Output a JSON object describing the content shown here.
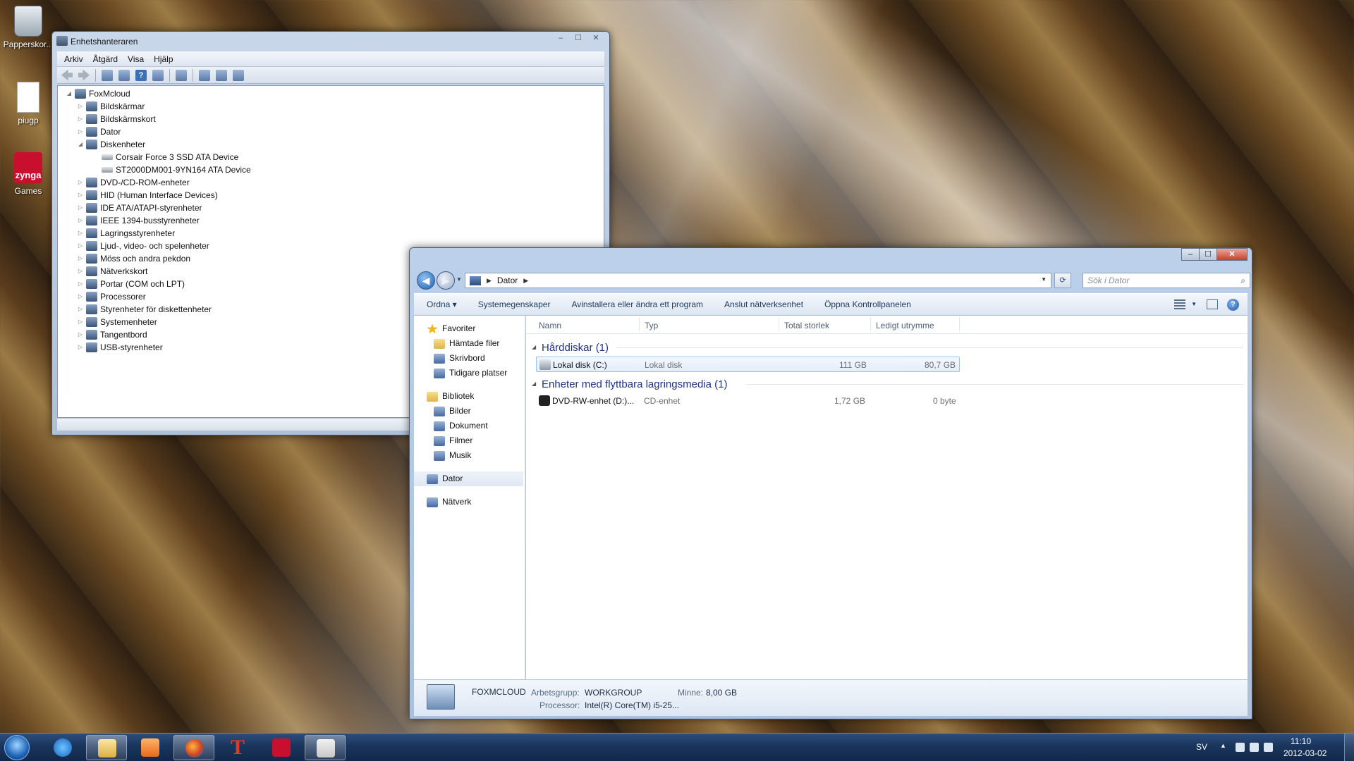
{
  "desktop": {
    "icons": [
      {
        "label": "Papperskor..."
      },
      {
        "label": "piugp"
      },
      {
        "label": "Games",
        "logo_text": "zynga"
      }
    ]
  },
  "devmgr": {
    "title": "Enhetshanteraren",
    "window_buttons": {
      "minimize": "‒",
      "maximize": "☐",
      "close": "✕"
    },
    "menu": [
      "Arkiv",
      "Åtgärd",
      "Visa",
      "Hjälp"
    ],
    "tree": {
      "root": "FoxMcloud",
      "items": [
        {
          "label": "Bildskärmar",
          "expanded": false
        },
        {
          "label": "Bildskärmskort",
          "expanded": false
        },
        {
          "label": "Dator",
          "expanded": false
        },
        {
          "label": "Diskenheter",
          "expanded": true,
          "children": [
            "Corsair Force 3 SSD ATA Device",
            "ST2000DM001-9YN164 ATA Device"
          ]
        },
        {
          "label": "DVD-/CD-ROM-enheter",
          "expanded": false
        },
        {
          "label": "HID (Human Interface Devices)",
          "expanded": false
        },
        {
          "label": "IDE ATA/ATAPI-styrenheter",
          "expanded": false
        },
        {
          "label": "IEEE 1394-busstyrenheter",
          "expanded": false
        },
        {
          "label": "Lagringsstyrenheter",
          "expanded": false
        },
        {
          "label": "Ljud-, video- och spelenheter",
          "expanded": false
        },
        {
          "label": "Möss och andra pekdon",
          "expanded": false
        },
        {
          "label": "Nätverkskort",
          "expanded": false
        },
        {
          "label": "Portar (COM och LPT)",
          "expanded": false
        },
        {
          "label": "Processorer",
          "expanded": false
        },
        {
          "label": "Styrenheter för diskettenheter",
          "expanded": false
        },
        {
          "label": "Systemenheter",
          "expanded": false
        },
        {
          "label": "Tangentbord",
          "expanded": false
        },
        {
          "label": "USB-styrenheter",
          "expanded": false
        }
      ]
    }
  },
  "explorer": {
    "window_buttons": {
      "minimize": "‒",
      "maximize": "☐",
      "close": "✕"
    },
    "address": {
      "location": "Dator"
    },
    "search_placeholder": "Sök i Dator",
    "commands": [
      "Ordna ▾",
      "Systemegenskaper",
      "Avinstallera eller ändra ett program",
      "Anslut nätverksenhet",
      "Öppna Kontrollpanelen"
    ],
    "nav": {
      "favorites": {
        "label": "Favoriter",
        "items": [
          "Hämtade filer",
          "Skrivbord",
          "Tidigare platser"
        ]
      },
      "libraries": {
        "label": "Bibliotek",
        "items": [
          "Bilder",
          "Dokument",
          "Filmer",
          "Musik"
        ]
      },
      "computer": "Dator",
      "network": "Nätverk"
    },
    "columns": [
      "Namn",
      "Typ",
      "Total storlek",
      "Ledigt utrymme"
    ],
    "groups": [
      {
        "label": "Hårddiskar (1)",
        "rows": [
          {
            "name": "Lokal disk (C:)",
            "type": "Lokal disk",
            "total": "111 GB",
            "free": "80,7 GB"
          }
        ]
      },
      {
        "label": "Enheter med flyttbara lagringsmedia (1)",
        "rows": [
          {
            "name": "DVD-RW-enhet (D:)...",
            "type": "CD-enhet",
            "total": "1,72 GB",
            "free": "0 byte"
          }
        ]
      }
    ],
    "details": {
      "name": "FOXMCLOUD",
      "workgroup_label": "Arbetsgrupp:",
      "workgroup": "WORKGROUP",
      "memory_label": "Minne:",
      "memory": "8,00 GB",
      "processor_label": "Processor:",
      "processor": "Intel(R) Core(TM) i5-25..."
    }
  },
  "taskbar": {
    "language": "SV",
    "time": "11:10",
    "date": "2012-03-02",
    "pinned": [
      "start-orb",
      "internet-explorer",
      "windows-explorer",
      "media-player",
      "firefox",
      "t-app",
      "zynga",
      "device-manager"
    ]
  }
}
